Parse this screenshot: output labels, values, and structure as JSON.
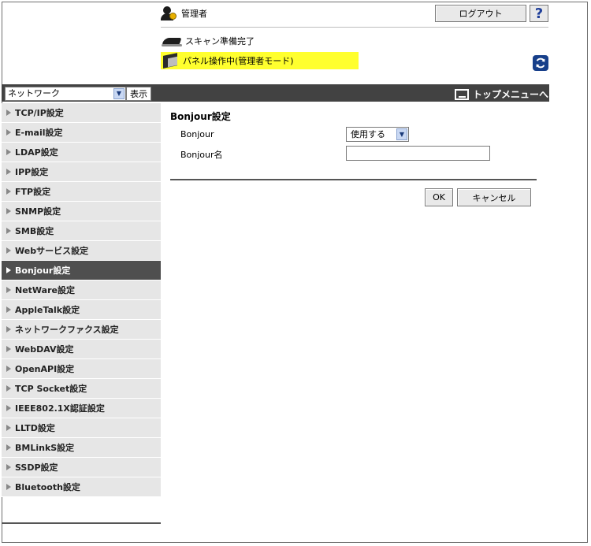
{
  "header": {
    "user_label": "管理者",
    "logout_label": "ログアウト",
    "help_label": "?",
    "status_scan": "スキャン準備完了",
    "status_panel": "パネル操作中(管理者モード)"
  },
  "toolbar": {
    "category_value": "ネットワーク",
    "display_label": "表示",
    "top_menu_label": "トップメニューへ"
  },
  "sidebar": {
    "items": [
      {
        "label": "TCP/IP設定"
      },
      {
        "label": "E-mail設定"
      },
      {
        "label": "LDAP設定"
      },
      {
        "label": "IPP設定"
      },
      {
        "label": "FTP設定"
      },
      {
        "label": "SNMP設定"
      },
      {
        "label": "SMB設定"
      },
      {
        "label": "Webサービス設定"
      },
      {
        "label": "Bonjour設定",
        "active": true
      },
      {
        "label": "NetWare設定"
      },
      {
        "label": "AppleTalk設定"
      },
      {
        "label": "ネットワークファクス設定"
      },
      {
        "label": "WebDAV設定"
      },
      {
        "label": "OpenAPI設定"
      },
      {
        "label": "TCP Socket設定"
      },
      {
        "label": "IEEE802.1X認証設定"
      },
      {
        "label": "LLTD設定"
      },
      {
        "label": "BMLinkS設定"
      },
      {
        "label": "SSDP設定"
      },
      {
        "label": "Bluetooth設定"
      }
    ]
  },
  "main": {
    "title": "Bonjour設定",
    "bonjour_label": "Bonjour",
    "bonjour_value": "使用する",
    "bonjour_name_label": "Bonjour名",
    "bonjour_name_value": "",
    "ok_label": "OK",
    "cancel_label": "キャンセル"
  },
  "colors": {
    "bar": "#424242",
    "active_item": "#4f4f4f",
    "status_highlight": "#ffff2e",
    "sidebar_bg": "#e6e6e6"
  }
}
